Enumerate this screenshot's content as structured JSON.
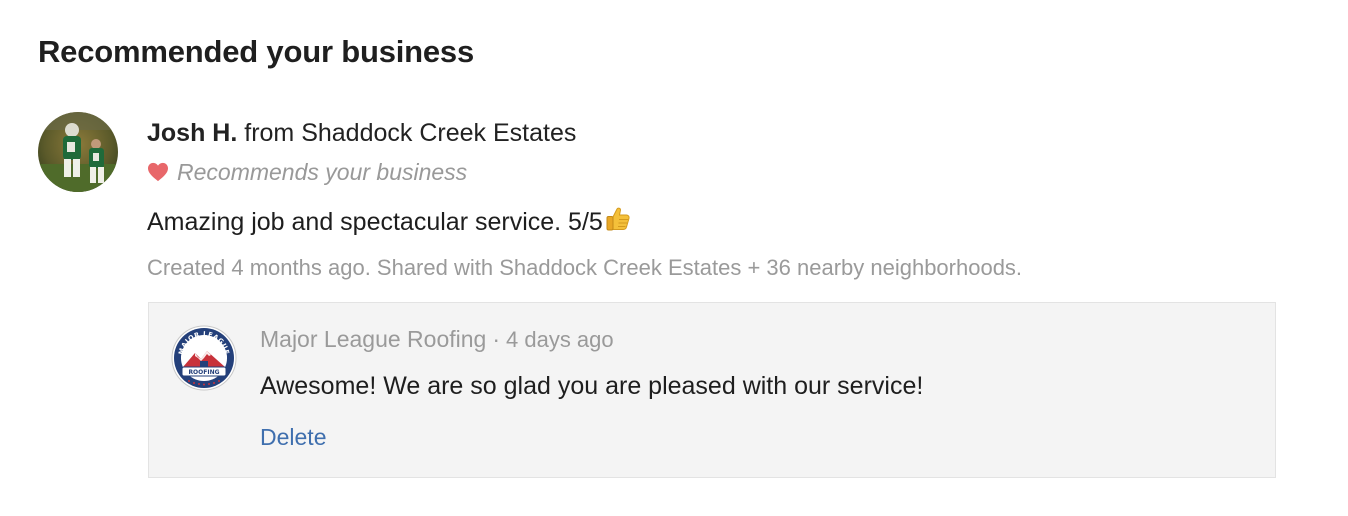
{
  "section": {
    "title": "Recommended your business"
  },
  "recommendation": {
    "author_name": "Josh H.",
    "author_from": "from Shaddock Creek Estates",
    "recommend_label": "Recommends your business",
    "body_text": "Amazing job and spectacular service. 5/5",
    "meta": "Created 4 months ago. Shared with Shaddock Creek Estates + 36 nearby neighborhoods.",
    "avatar_icon": "user-photo-avatar",
    "heart_icon": "heart-icon",
    "heart_color": "#e8676a",
    "emoji_icon": "thumbs-up-icon"
  },
  "reply": {
    "business_name": "Major League Roofing",
    "separator": "·",
    "time": "4 days ago",
    "text": "Awesome! We are so glad you are pleased with our service!",
    "delete_label": "Delete",
    "logo_text_top": "MAJOR LEAGUE",
    "logo_text_bottom": "ROOFING",
    "link_color": "#3f6fae",
    "box_background": "#f4f4f4"
  }
}
